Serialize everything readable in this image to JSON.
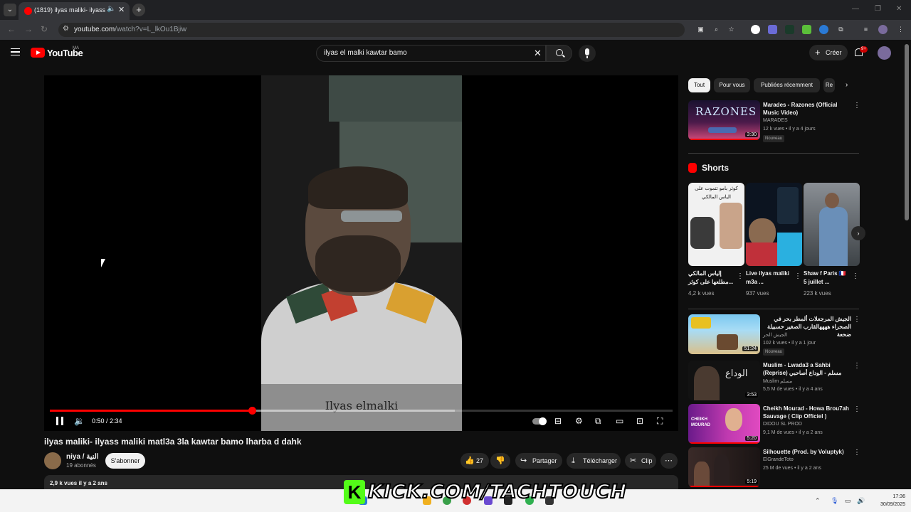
{
  "browser": {
    "tab_title": "(1819) ilyas maliki- ilyass m",
    "url_host": "youtube.com",
    "url_path": "/watch?v=L_lkOu1Bjiw"
  },
  "header": {
    "logo_text": "YouTube",
    "region": "MA",
    "search_value": "ilyas el malki kawtar bamo",
    "create_label": "Créer",
    "notif_badge": "9+"
  },
  "player": {
    "caption": "Ilyas elmalki",
    "time": "0:50 / 2:34",
    "progress": 0.3247,
    "buffered": 0.65
  },
  "video": {
    "title": "ilyas maliki- ilyass maliki matl3a 3la kawtar bamo lharba d dahk",
    "channel": "niya / النية",
    "subscribers": "19 abonnés",
    "subscribe_label": "S'abonner",
    "likes": "27",
    "share_label": "Partager",
    "download_label": "Télécharger",
    "clip_label": "Clip",
    "views_date": "2,9 k vues  il y a 2 ans"
  },
  "chips": [
    "Tout",
    "Pour vous",
    "Publiées récemment",
    "Re"
  ],
  "shorts_label": "Shorts",
  "shorts": [
    {
      "title": "إلياس المالكي مطلعها على كوثر...",
      "views": "4,2 k vues",
      "thumb_text": "كوثر بامو تتموت على الياس المالكي"
    },
    {
      "title": "Live ilyas maliki m3a ...",
      "views": "937 vues"
    },
    {
      "title": "Shaw f Paris 🇫🇷 5 juillet ...",
      "views": "223 k vues"
    }
  ],
  "recommendations": [
    {
      "title": "Marades - Razones (Official Music Video)",
      "channel": "MARADES",
      "meta": "12 k vues • il y a 4 jours",
      "badge": "Nouveau",
      "duration": "3:30",
      "thumb_text": "RAZONES",
      "progress": 1.0
    },
    {
      "title": "الجيش المرجعلات ألمطر بحر في الصحراء ههههالقارب الصغير حسبيلة ضحعة",
      "channel": "الجيش الحر",
      "meta": "102 k vues • il y a 1 jour",
      "badge": "Nouveau",
      "duration": "51:24",
      "progress": 0
    },
    {
      "title": "Muslim - Lwada3 a Sahbi (Reprise) مسلم - الوداع أصاحبي",
      "channel": "Muslim مسلم",
      "meta": "5,5 M de vues • il y a 4 ans",
      "duration": "3:53",
      "thumb_text": "الوداع",
      "progress": 0
    },
    {
      "title": "Cheikh Mourad - Howa Brou7ah Sauvage ( Clip Officiel )",
      "channel": "DIDOU SL PROD",
      "meta": "9,1 M de vues • il y a 2 ans",
      "duration": "5:20",
      "thumb_text": "CHEIKH MOURAD",
      "progress": 1.0
    },
    {
      "title": "Silhouette (Prod. by Voluptyk)",
      "channel": "ElGrandeToto",
      "meta": "25 M de vues • il y a 2 ans",
      "duration": "5:19",
      "progress": 1.0
    }
  ],
  "overlay": {
    "kick_text": "KICK.COM/TACHTOUCH"
  },
  "taskbar": {
    "time": "17:36",
    "date": "30/09/2025"
  },
  "colors": {
    "accent": "#ff0000",
    "kick_green": "#53fc18",
    "bg": "#0f0f0f"
  }
}
